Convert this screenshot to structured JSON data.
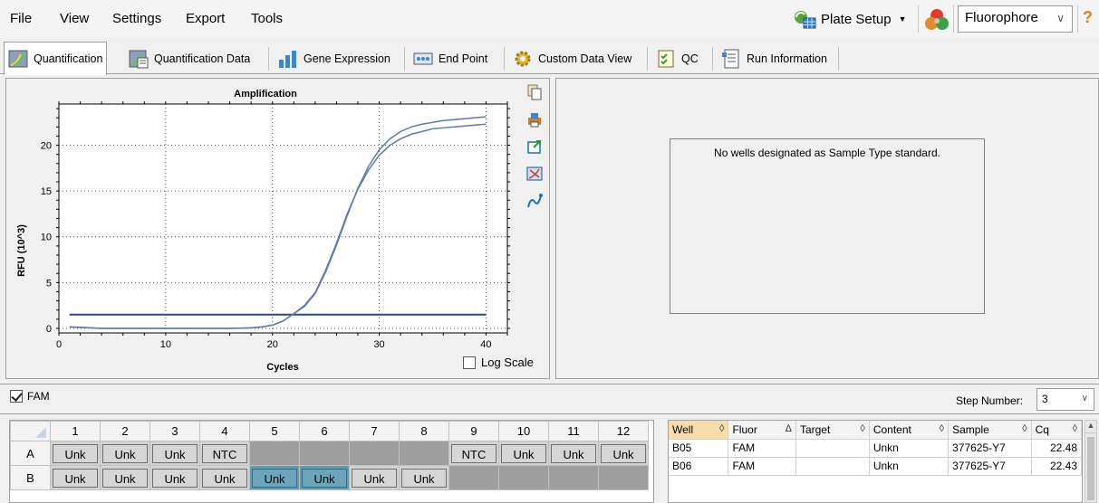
{
  "menu": {
    "items": [
      "File",
      "View",
      "Settings",
      "Export",
      "Tools"
    ]
  },
  "toolbar": {
    "plate_setup_label": "Plate Setup",
    "fluorophore_value": "Fluorophore",
    "help_label": "?"
  },
  "tabs": [
    {
      "label": "Quantification",
      "icon": "quantification-icon",
      "active": true
    },
    {
      "label": "Quantification Data",
      "icon": "quantification-data-icon"
    },
    {
      "label": "Gene Expression",
      "icon": "bar-chart-icon"
    },
    {
      "label": "End Point",
      "icon": "end-point-icon"
    },
    {
      "label": "Custom Data View",
      "icon": "gear-icon"
    },
    {
      "label": "QC",
      "icon": "checklist-icon"
    },
    {
      "label": "Run Information",
      "icon": "document-icon"
    }
  ],
  "chart_data": {
    "type": "line",
    "title": "Amplification",
    "xlabel": "Cycles",
    "ylabel": "RFU (10^3)",
    "xlim": [
      0,
      42
    ],
    "ylim": [
      -0.5,
      24.5
    ],
    "xticks": [
      0,
      10,
      20,
      30,
      40
    ],
    "yticks": [
      0,
      5,
      10,
      15,
      20
    ],
    "grid": "dotted",
    "series": [
      {
        "x": [
          1,
          2,
          3,
          4,
          5,
          6,
          7,
          8,
          9,
          10,
          11,
          12,
          13,
          14,
          15,
          16,
          17,
          18,
          19,
          20,
          21,
          22,
          23,
          24,
          25,
          26,
          27,
          28,
          29,
          30,
          31,
          32,
          33,
          34,
          35,
          36,
          37,
          38,
          39,
          40
        ],
        "values": [
          0.15,
          0.1,
          0.05,
          0,
          0,
          0,
          0,
          0,
          0,
          0,
          0,
          0,
          0,
          0,
          0,
          0,
          0.02,
          0.05,
          0.15,
          0.35,
          0.8,
          1.6,
          2.4,
          3.8,
          6.2,
          9.1,
          12.3,
          15.3,
          17.7,
          19.5,
          20.7,
          21.5,
          22,
          22.3,
          22.5,
          22.7,
          22.8,
          22.9,
          23,
          23.1
        ],
        "color": "#5d7aa8"
      },
      {
        "x": [
          1,
          2,
          3,
          4,
          5,
          6,
          7,
          8,
          9,
          10,
          11,
          12,
          13,
          14,
          15,
          16,
          17,
          18,
          19,
          20,
          21,
          22,
          23,
          24,
          25,
          26,
          27,
          28,
          29,
          30,
          31,
          32,
          33,
          34,
          35,
          36,
          37,
          38,
          39,
          40
        ],
        "values": [
          0.15,
          0.1,
          0.05,
          0,
          0,
          0,
          0,
          0,
          0,
          0,
          0,
          0,
          0,
          0,
          0,
          0,
          0.02,
          0.05,
          0.15,
          0.35,
          0.8,
          1.6,
          2.5,
          3.9,
          6.4,
          9.3,
          12.5,
          15.2,
          17.3,
          18.9,
          20,
          20.7,
          21.2,
          21.5,
          21.8,
          21.9,
          22,
          22.1,
          22.2,
          22.3
        ],
        "color": "#5d7aa8"
      }
    ],
    "threshold": {
      "value": 1.5,
      "color": "#1f4e8c"
    },
    "log_scale_label": "Log Scale",
    "log_scale_checked": false
  },
  "chart_tools": [
    "copy-icon",
    "print-icon",
    "export-icon",
    "zoom-icon",
    "curve-style-icon"
  ],
  "standard_panel": {
    "message": "No wells designated as Sample Type standard."
  },
  "fluor_filter": {
    "label": "FAM",
    "checked": true
  },
  "step": {
    "label": "Step Number:",
    "value": "3"
  },
  "plate": {
    "columns": [
      "1",
      "2",
      "3",
      "4",
      "5",
      "6",
      "7",
      "8",
      "9",
      "10",
      "11",
      "12"
    ],
    "rows": [
      {
        "label": "A",
        "cells": [
          "Unk",
          "Unk",
          "Unk",
          "NTC",
          "",
          "",
          "",
          "",
          "NTC",
          "Unk",
          "Unk",
          "Unk"
        ],
        "state": [
          "f",
          "f",
          "f",
          "f",
          "e",
          "e",
          "e",
          "e",
          "f",
          "f",
          "f",
          "f"
        ]
      },
      {
        "label": "B",
        "cells": [
          "Unk",
          "Unk",
          "Unk",
          "Unk",
          "Unk",
          "Unk",
          "Unk",
          "Unk",
          "",
          "",
          "",
          ""
        ],
        "state": [
          "f",
          "f",
          "f",
          "f",
          "s",
          "s",
          "f",
          "f",
          "e",
          "e",
          "e",
          "e"
        ]
      }
    ]
  },
  "well_table": {
    "headers": [
      "Well",
      "Fluor",
      "Target",
      "Content",
      "Sample",
      "Cq"
    ],
    "sort_marks": [
      "◊",
      "Δ",
      "◊",
      "◊",
      "◊",
      "◊"
    ],
    "rows": [
      {
        "well": "B05",
        "fluor": "FAM",
        "target": "",
        "content": "Unkn",
        "sample": "377625-Y7",
        "cq": "22.48"
      },
      {
        "well": "B06",
        "fluor": "FAM",
        "target": "",
        "content": "Unkn",
        "sample": "377625-Y7",
        "cq": "22.43"
      }
    ]
  }
}
